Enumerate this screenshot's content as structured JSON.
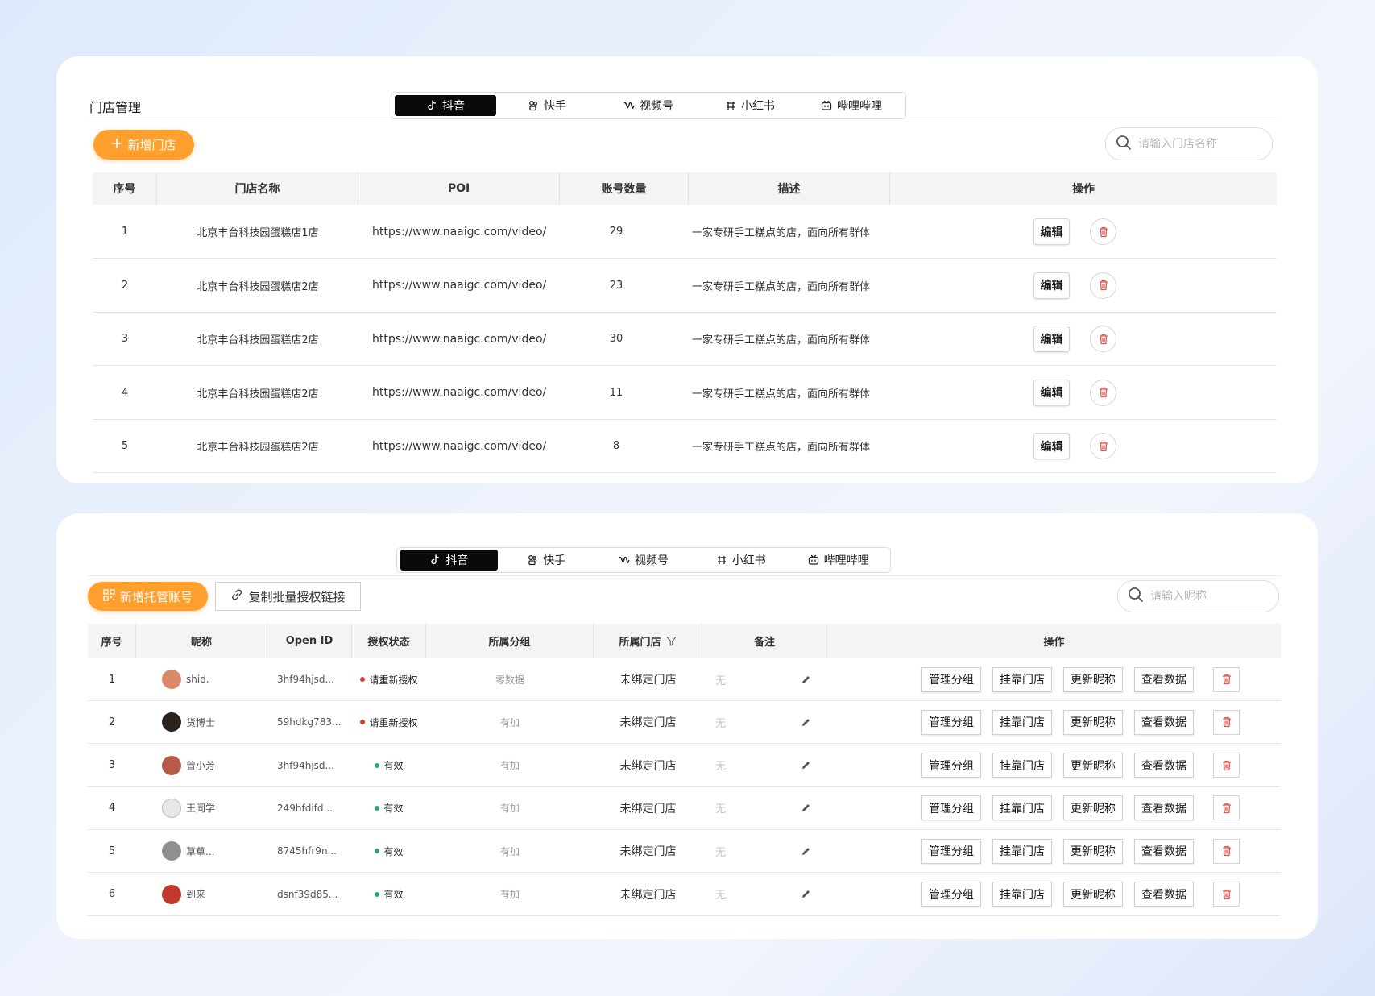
{
  "colors": {
    "accent": "#ff9f2e",
    "danger": "#e5534b",
    "active_tab": "#0a0a0a",
    "status_red": "#e03b32",
    "status_green": "#2aa77a"
  },
  "platform_tabs": [
    {
      "label": "抖音",
      "icon": "douyin-icon"
    },
    {
      "label": "快手",
      "icon": "kuaishou-icon"
    },
    {
      "label": "视频号",
      "icon": "shipinhao-icon"
    },
    {
      "label": "小红书",
      "icon": "xiaohongshu-icon"
    },
    {
      "label": "哔哩哔哩",
      "icon": "bilibili-icon"
    }
  ],
  "store_panel": {
    "title": "门店管理",
    "active_tab": "抖音",
    "add_button": "新增门店",
    "search_placeholder": "请输入门店名称",
    "columns": [
      "序号",
      "门店名称",
      "POI",
      "账号数量",
      "描述",
      "操作"
    ],
    "edit_label": "编辑",
    "rows": [
      {
        "index": "1",
        "name": "北京丰台科技园蛋糕店1店",
        "poi": "https://www.naaigc.com/video/",
        "count": "29",
        "desc": "一家专研手工糕点的店，面向所有群体"
      },
      {
        "index": "2",
        "name": "北京丰台科技园蛋糕店2店",
        "poi": "https://www.naaigc.com/video/",
        "count": "23",
        "desc": "一家专研手工糕点的店，面向所有群体"
      },
      {
        "index": "3",
        "name": "北京丰台科技园蛋糕店2店",
        "poi": "https://www.naaigc.com/video/",
        "count": "30",
        "desc": "一家专研手工糕点的店，面向所有群体"
      },
      {
        "index": "4",
        "name": "北京丰台科技园蛋糕店2店",
        "poi": "https://www.naaigc.com/video/",
        "count": "11",
        "desc": "一家专研手工糕点的店，面向所有群体"
      },
      {
        "index": "5",
        "name": "北京丰台科技园蛋糕店2店",
        "poi": "https://www.naaigc.com/video/",
        "count": "8",
        "desc": "一家专研手工糕点的店，面向所有群体"
      }
    ]
  },
  "account_panel": {
    "active_tab": "抖音",
    "add_button": "新增托管账号",
    "copy_button": "复制批量授权链接",
    "search_placeholder": "请输入昵称",
    "columns": [
      "序号",
      "昵称",
      "Open ID",
      "授权状态",
      "所属分组",
      "所属门店",
      "备注",
      "操作"
    ],
    "actions": [
      "管理分组",
      "挂靠门店",
      "更新昵称",
      "查看数据"
    ],
    "rows": [
      {
        "index": "1",
        "nickname": "shid.",
        "avatar_color": "#d98a6a",
        "open_id": "3hf94hjsd...",
        "status": "请重新授权",
        "status_type": "red",
        "group": "零数据",
        "store": "未绑定门店",
        "note": "无"
      },
      {
        "index": "2",
        "nickname": "货博士",
        "avatar_color": "#2b2220",
        "open_id": "59hdkg783...",
        "status": "请重新授权",
        "status_type": "red",
        "group": "有加",
        "store": "未绑定门店",
        "note": "无"
      },
      {
        "index": "3",
        "nickname": "曾小芳",
        "avatar_color": "#b65a4a",
        "open_id": "3hf94hjsd...",
        "status": "有效",
        "status_type": "green",
        "group": "有加",
        "store": "未绑定门店",
        "note": "无"
      },
      {
        "index": "4",
        "nickname": "王同学",
        "avatar_color": "#e8e8e8",
        "open_id": "249hfdifd...",
        "status": "有效",
        "status_type": "green",
        "group": "有加",
        "store": "未绑定门店",
        "note": "无"
      },
      {
        "index": "5",
        "nickname": "草草...",
        "avatar_color": "#8f8f8f",
        "open_id": "8745hfr9n...",
        "status": "有效",
        "status_type": "green",
        "group": "有加",
        "store": "未绑定门店",
        "note": "无"
      },
      {
        "index": "6",
        "nickname": "到来",
        "avatar_color": "#c0392b",
        "open_id": "dsnf39d85...",
        "status": "有效",
        "status_type": "green",
        "group": "有加",
        "store": "未绑定门店",
        "note": "无"
      }
    ]
  }
}
